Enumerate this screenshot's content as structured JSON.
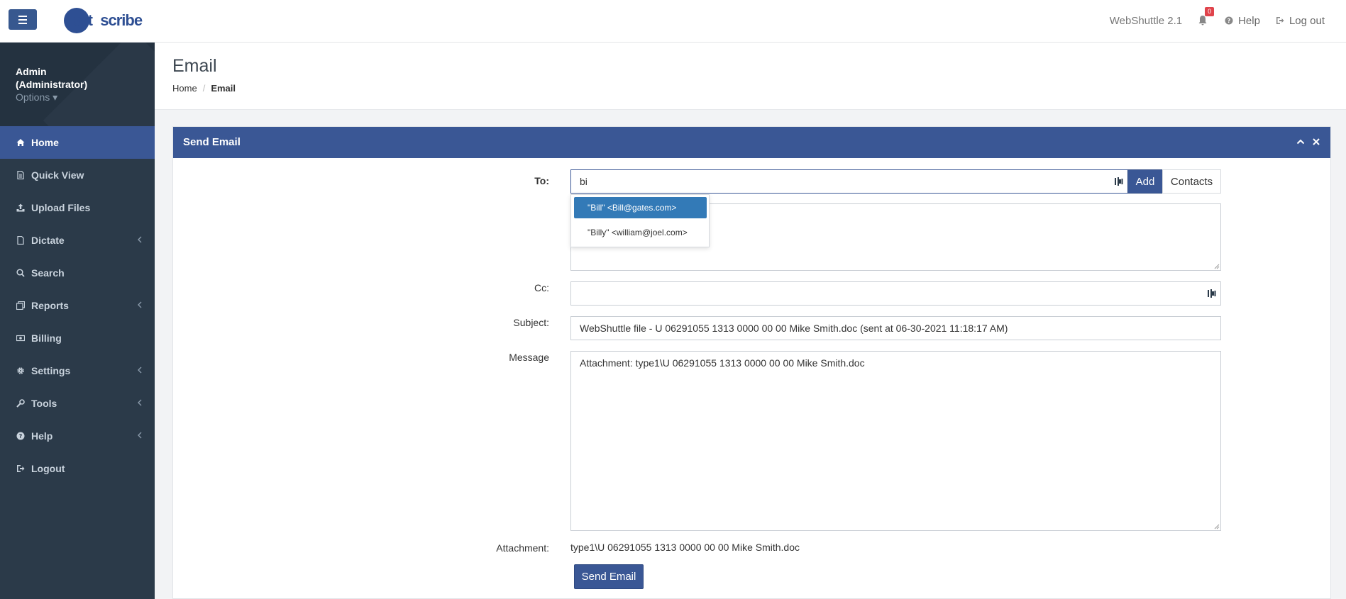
{
  "app": {
    "logo_text_dark_1": "byt",
    "logo_text_light": "e",
    "logo_text_dark_2": "scribe",
    "version": "WebShuttle 2.1",
    "notification_count": "0",
    "help_label": "Help",
    "logout_label": "Log out",
    "colors": {
      "primary": "#3a5795",
      "sidebar": "#2b3a49",
      "badge": "#e0434b",
      "suggest_highlight": "#337ab7"
    }
  },
  "sidebar": {
    "user_name": "Admin (Administrator)",
    "options_label": "Options ▾",
    "items": [
      {
        "label": "Home",
        "icon": "home-icon",
        "active": true
      },
      {
        "label": "Quick View",
        "icon": "file-icon"
      },
      {
        "label": "Upload Files",
        "icon": "upload-icon"
      },
      {
        "label": "Dictate",
        "icon": "document-icon",
        "submenu": true
      },
      {
        "label": "Search",
        "icon": "search-icon"
      },
      {
        "label": "Reports",
        "icon": "reports-icon",
        "submenu": true
      },
      {
        "label": "Billing",
        "icon": "money-icon"
      },
      {
        "label": "Settings",
        "icon": "gear-icon",
        "submenu": true
      },
      {
        "label": "Tools",
        "icon": "wrench-icon",
        "submenu": true
      },
      {
        "label": "Help",
        "icon": "question-icon",
        "submenu": true
      },
      {
        "label": "Logout",
        "icon": "logout-icon"
      }
    ]
  },
  "header": {
    "title": "Email",
    "breadcrumb": [
      "Home",
      "Email"
    ]
  },
  "panel": {
    "title": "Send Email"
  },
  "form": {
    "to_label": "To:",
    "to_value": "bi",
    "add_label": "Add",
    "contacts_label": "Contacts",
    "suggestions": [
      {
        "label": "\"Bill\" <Bill@gates.com>"
      },
      {
        "label": "\"Billy\" <william@joel.com>"
      }
    ],
    "cc_label": "Cc:",
    "cc_value": "",
    "subject_label": "Subject:",
    "subject_value": "WebShuttle file - U 06291055 1313 0000 00 00 Mike Smith.doc (sent at 06-30-2021 11:18:17 AM)",
    "message_label": "Message",
    "message_value": "Attachment:  type1\\U 06291055 1313 0000 00 00 Mike Smith.doc",
    "attachment_label": "Attachment:",
    "attachment_value": "type1\\U 06291055 1313 0000 00 00 Mike Smith.doc",
    "send_label": "Send Email"
  }
}
